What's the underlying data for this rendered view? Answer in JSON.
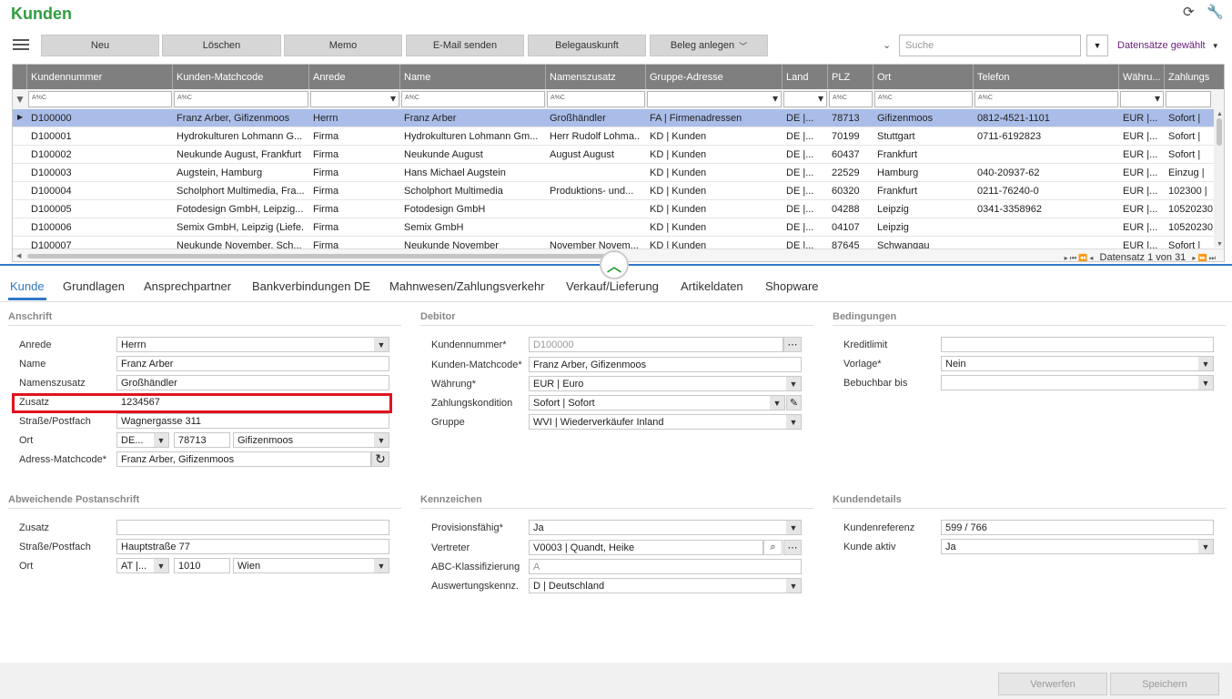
{
  "app": {
    "title": "Kunden"
  },
  "toolbar": {
    "buttons": [
      "Neu",
      "Löschen",
      "Memo",
      "E-Mail senden",
      "Belegauskunft",
      "Beleg anlegen"
    ],
    "search_placeholder": "Suche",
    "datasets_label": "Datensätze gewählt"
  },
  "grid": {
    "columns": [
      "Kundennummer",
      "Kunden-Matchcode",
      "Anrede",
      "Name",
      "Namenszusatz",
      "Gruppe-Adresse",
      "Land",
      "PLZ",
      "Ort",
      "Telefon",
      "Währu...",
      "Zahlungs"
    ],
    "filter_hint": "A%C",
    "rows": [
      [
        "D100000",
        "Franz Arber, Gifizenmoos",
        "Herrn",
        "Franz Arber",
        "Großhändler",
        "FA  |  Firmenadressen",
        "DE  |...",
        "78713",
        "Gifizenmoos",
        "0812-4521-1101",
        "EUR  |...",
        "Sofort  |"
      ],
      [
        "D100001",
        "Hydrokulturen Lohmann G...",
        "Firma",
        "Hydrokulturen Lohmann Gm...",
        "Herr Rudolf Lohma...",
        "KD  |  Kunden",
        "DE  |...",
        "70199",
        "Stuttgart",
        "0711-6192823",
        "EUR  |...",
        "Sofort  |"
      ],
      [
        "D100002",
        "Neukunde August, Frankfurt",
        "Firma",
        "Neukunde August",
        "August August",
        "KD  |  Kunden",
        "DE  |...",
        "60437",
        "Frankfurt",
        "",
        "EUR  |...",
        "Sofort  |"
      ],
      [
        "D100003",
        "Augstein, Hamburg",
        "Firma",
        "Hans Michael Augstein",
        "",
        "KD  |  Kunden",
        "DE  |...",
        "22529",
        "Hamburg",
        "040-20937-62",
        "EUR  |...",
        "Einzug  |"
      ],
      [
        "D100004",
        "Scholphort Multimedia, Fra...",
        "Firma",
        "Scholphort Multimedia",
        "Produktions- und...",
        "KD  |  Kunden",
        "DE  |...",
        "60320",
        "Frankfurt",
        "0211-76240-0",
        "EUR  |...",
        "102300  |"
      ],
      [
        "D100005",
        "Fotodesign GmbH, Leipzig...",
        "Firma",
        "Fotodesign GmbH",
        "",
        "KD  |  Kunden",
        "DE  |...",
        "04288",
        "Leipzig",
        "0341-3358962",
        "EUR  |...",
        "10520230"
      ],
      [
        "D100006",
        "Semix GmbH, Leipzig (Liefe...",
        "Firma",
        "Semix GmbH",
        "",
        "KD  |  Kunden",
        "DE  |...",
        "04107",
        "Leipzig",
        "",
        "EUR  |...",
        "10520230"
      ],
      [
        "D100007",
        "Neukunde November, Sch...",
        "Firma",
        "Neukunde November",
        "November Novem...",
        "KD  |  Kunden",
        "DE  |...",
        "87645",
        "Schwangau",
        "",
        "EUR  |...",
        "Sofort  |"
      ]
    ],
    "pager": "Datensatz 1 von 31"
  },
  "tabs": [
    "Kunde",
    "Grundlagen",
    "Ansprechpartner",
    "Bankverbindungen DE",
    "Mahnwesen/Zahlungsverkehr",
    "Verkauf/Lieferung",
    "Artikeldaten",
    "Shopware"
  ],
  "anschrift": {
    "title": "Anschrift",
    "anrede_label": "Anrede",
    "anrede": "Herrn",
    "name_label": "Name",
    "name": "Franz Arber",
    "namenszusatz_label": "Namenszusatz",
    "namenszusatz": "Großhändler",
    "zusatz_label": "Zusatz",
    "zusatz": "1234567",
    "strasse_label": "Straße/Postfach",
    "strasse": "Wagnergasse 311",
    "ort_label": "Ort",
    "land": "DE...",
    "plz": "78713",
    "ort": "Gifizenmoos",
    "matchcode_label": "Adress-Matchcode*",
    "matchcode": "Franz Arber, Gifizenmoos"
  },
  "debitor": {
    "title": "Debitor",
    "kundennummer_label": "Kundennummer*",
    "kundennummer": "D100000",
    "matchcode_label": "Kunden-Matchcode*",
    "matchcode": "Franz Arber, Gifizenmoos",
    "waehrung_label": "Währung*",
    "waehrung": "EUR  |  Euro",
    "zahlung_label": "Zahlungskondition",
    "zahlung": "Sofort  |  Sofort",
    "gruppe_label": "Gruppe",
    "gruppe": "WVI  |  Wiederverkäufer Inland"
  },
  "bedingungen": {
    "title": "Bedingungen",
    "kreditlimit_label": "Kreditlimit",
    "kreditlimit": "",
    "vorlage_label": "Vorlage*",
    "vorlage": "Nein",
    "bebuchbar_label": "Bebuchbar bis",
    "bebuchbar": ""
  },
  "postanschrift": {
    "title": "Abweichende Postanschrift",
    "zusatz_label": "Zusatz",
    "zusatz": "",
    "strasse_label": "Straße/Postfach",
    "strasse": "Hauptstraße 77",
    "ort_label": "Ort",
    "land": "AT  |...",
    "plz": "1010",
    "ort": "Wien"
  },
  "kennzeichen": {
    "title": "Kennzeichen",
    "provision_label": "Provisionsfähig*",
    "provision": "Ja",
    "vertreter_label": "Vertreter",
    "vertreter": "V0003  |  Quandt, Heike",
    "abc_label": "ABC-Klassifizierung",
    "abc": "A",
    "auswertung_label": "Auswertungskennz.",
    "auswertung": "D  |  Deutschland"
  },
  "kundendetails": {
    "title": "Kundendetails",
    "referenz_label": "Kundenreferenz",
    "referenz": "599 / 766",
    "aktiv_label": "Kunde aktiv",
    "aktiv": "Ja"
  },
  "footer": {
    "verwerfen": "Verwerfen",
    "speichern": "Speichern"
  }
}
